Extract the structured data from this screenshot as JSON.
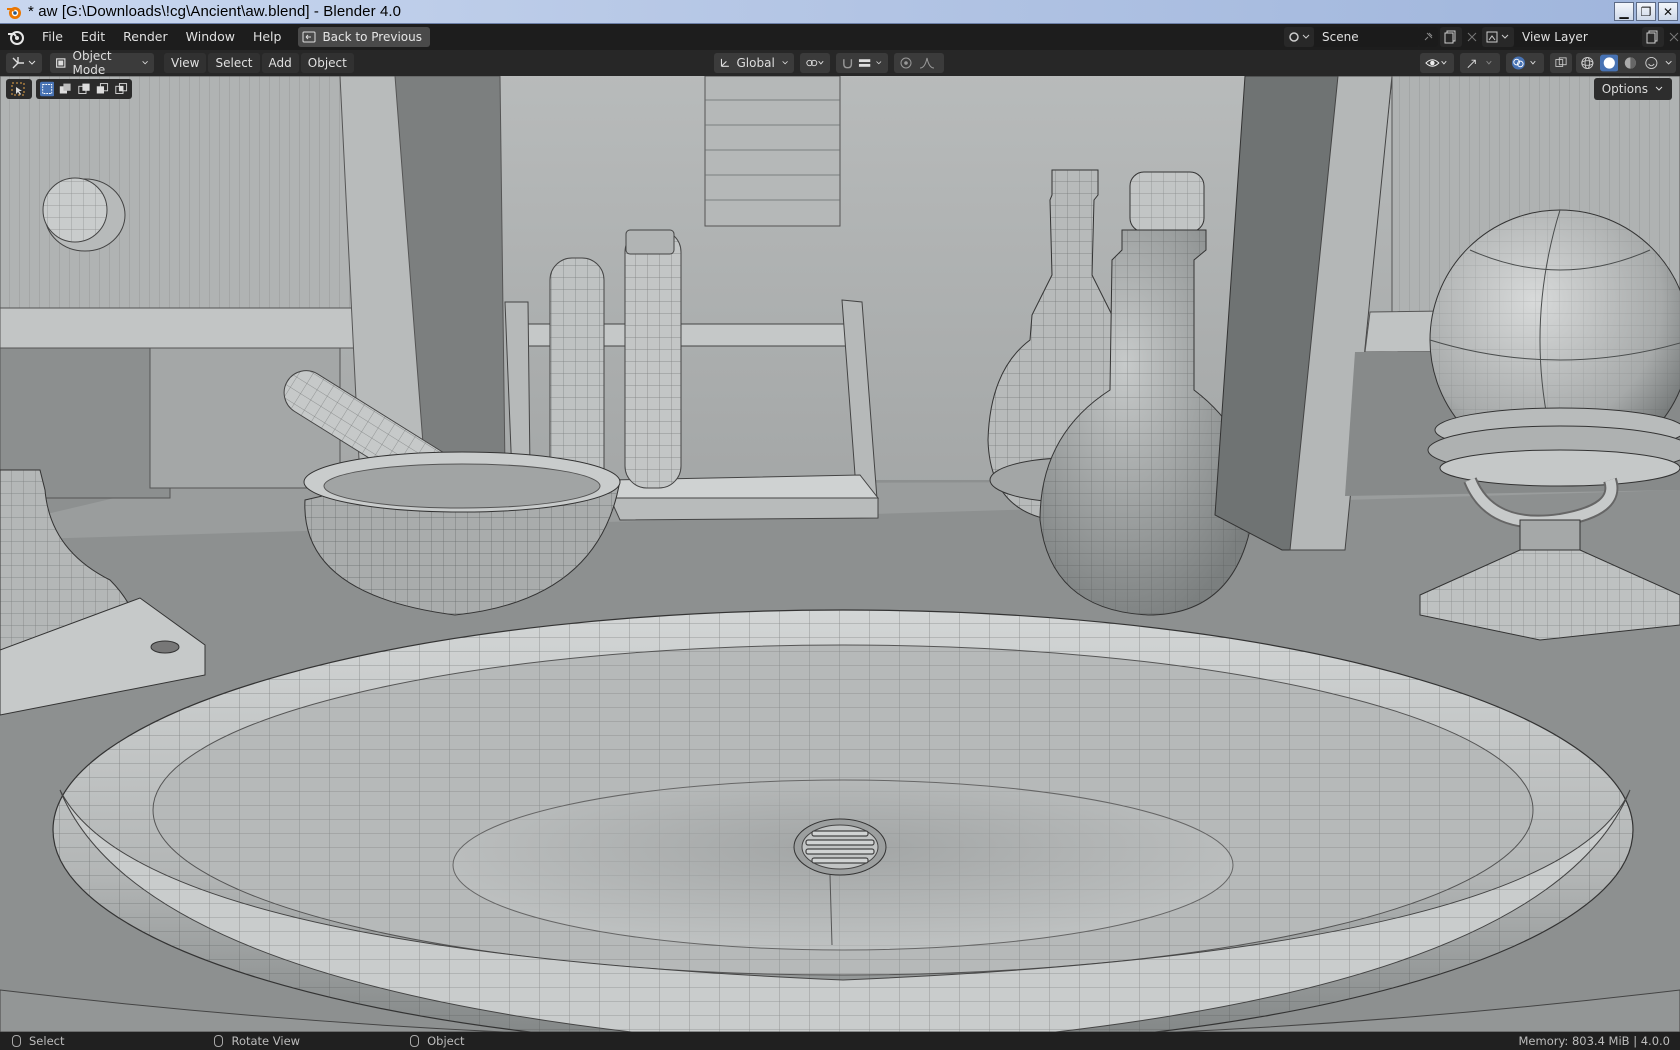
{
  "window": {
    "title": "* aw [G:\\Downloads\\!cg\\Ancient\\aw.blend] - Blender 4.0",
    "controls": [
      "minimize-icon",
      "restore-icon",
      "close-icon"
    ]
  },
  "menubar": {
    "items": [
      "File",
      "Edit",
      "Render",
      "Window",
      "Help"
    ],
    "back_button": "Back to Previous",
    "scene": "Scene",
    "view_layer": "View Layer"
  },
  "viewport_header": {
    "mode": "Object Mode",
    "menus": [
      "View",
      "Select",
      "Add",
      "Object"
    ],
    "transform_orientation": "Global",
    "options_label": "Options"
  },
  "statusbar": {
    "items": [
      {
        "icon": "mouse-left-icon",
        "label": "Select"
      },
      {
        "icon": "mouse-middle-icon",
        "label": "Rotate View"
      },
      {
        "icon": "mouse-right-icon",
        "label": "Object"
      }
    ],
    "memory": "Memory: 803.4 MiB | 4.0.0"
  },
  "colors": {
    "titlebar": "#b7c8e6",
    "ui_dark": "#1d1d1d",
    "viewport_bg": "#8e9090",
    "mesh_light": "#c8cbcb",
    "wire": "#3a3d3d"
  }
}
